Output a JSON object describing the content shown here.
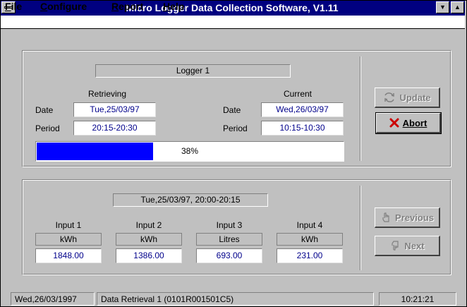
{
  "window": {
    "title": "Micro Logger Data Collection Software, V1.11"
  },
  "menu": {
    "file": {
      "underline": "F",
      "rest": "ile"
    },
    "configure": {
      "underline": "C",
      "rest": "onfigure"
    },
    "report": {
      "underline": "R",
      "rest": "eport"
    },
    "help": {
      "underline": "H",
      "rest": "elp"
    }
  },
  "retrieval": {
    "logger_name": "Logger 1",
    "retrieving_heading": "Retrieving",
    "current_heading": "Current",
    "date_label": "Date",
    "period_label": "Period",
    "retrieving_date": "Tue,25/03/97",
    "retrieving_period": "20:15-20:30",
    "current_date": "Wed,26/03/97",
    "current_period": "10:15-10:30",
    "progress_percent": 38,
    "progress_text": "38%"
  },
  "buttons": {
    "update": "Update",
    "abort": "Abort",
    "previous": "Previous",
    "next": "Next"
  },
  "readings": {
    "timestamp": "Tue,25/03/97, 20:00-20:15",
    "inputs": [
      {
        "label": "Input 1",
        "unit": "kWh",
        "value": "1848.00"
      },
      {
        "label": "Input 2",
        "unit": "kWh",
        "value": "1386.00"
      },
      {
        "label": "Input 3",
        "unit": "Litres",
        "value": "693.00"
      },
      {
        "label": "Input 4",
        "unit": "kWh",
        "value": "231.00"
      }
    ]
  },
  "statusbar": {
    "date": "Wed,26/03/1997",
    "message": "Data Retrieval 1 (0101R001501C5)",
    "time": "10:21:21"
  },
  "icons": {
    "update": "refresh-icon",
    "abort": "x-icon",
    "previous": "hand-up-icon",
    "next": "hand-down-icon"
  },
  "colors": {
    "titlebar": "#000080",
    "progress_fill": "#0000ff",
    "field_text": "#00008b",
    "abort_x": "#cc0000"
  }
}
